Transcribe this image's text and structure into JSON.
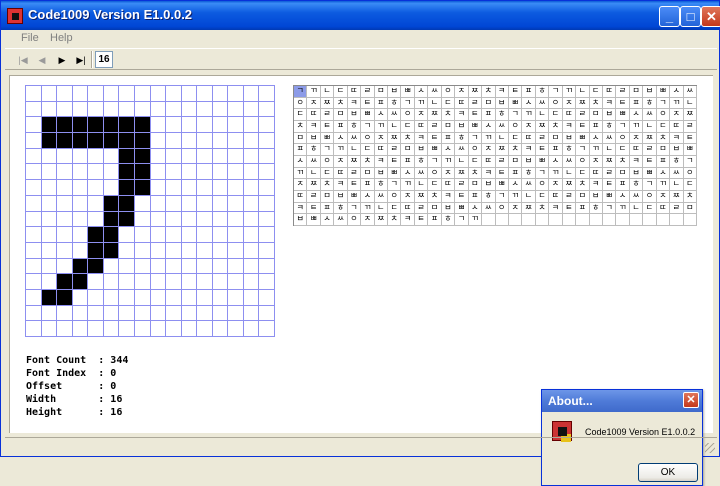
{
  "window": {
    "title": "Code1009 Version E1.0.0.2",
    "minimize_glyph": "_",
    "maximize_glyph": "□",
    "close_glyph": "✕",
    "icon": "app-icon"
  },
  "menu": {
    "file": "File",
    "help": "Help"
  },
  "toolbar": {
    "first_glyph": "|◀",
    "prev_glyph": "◀",
    "next_glyph": "▶",
    "last_glyph": "▶|",
    "index_value": "16"
  },
  "glyph": {
    "rows": 16,
    "cols": 16,
    "on_cells": [
      [
        2,
        1
      ],
      [
        2,
        2
      ],
      [
        2,
        3
      ],
      [
        2,
        4
      ],
      [
        2,
        5
      ],
      [
        2,
        6
      ],
      [
        2,
        7
      ],
      [
        3,
        1
      ],
      [
        3,
        2
      ],
      [
        3,
        3
      ],
      [
        3,
        4
      ],
      [
        3,
        5
      ],
      [
        3,
        6
      ],
      [
        3,
        7
      ],
      [
        4,
        6
      ],
      [
        4,
        7
      ],
      [
        5,
        6
      ],
      [
        5,
        7
      ],
      [
        6,
        6
      ],
      [
        6,
        7
      ],
      [
        7,
        5
      ],
      [
        7,
        6
      ],
      [
        8,
        5
      ],
      [
        8,
        6
      ],
      [
        9,
        4
      ],
      [
        9,
        5
      ],
      [
        10,
        4
      ],
      [
        10,
        5
      ],
      [
        11,
        3
      ],
      [
        11,
        4
      ],
      [
        12,
        2
      ],
      [
        12,
        3
      ],
      [
        13,
        1
      ],
      [
        13,
        2
      ]
    ]
  },
  "info": [
    {
      "label": "Font Count  : ",
      "value": "344"
    },
    {
      "label": "Font Index  : ",
      "value": "0"
    },
    {
      "label": "Offset      : ",
      "value": "0"
    },
    {
      "label": "Width       : ",
      "value": "16"
    },
    {
      "label": "Height      : ",
      "value": "16"
    }
  ],
  "font_table": {
    "cols": 30,
    "rows": 12,
    "filled_count": 344,
    "selected_index": 0,
    "glyphs": [
      "ㄱ",
      "ㄲ",
      "ㄴ",
      "ㄷ",
      "ㄸ",
      "ㄹ",
      "ㅁ",
      "ㅂ",
      "ㅃ",
      "ㅅ",
      "ㅆ",
      "ㅇ",
      "ㅈ",
      "ㅉ",
      "ㅊ",
      "ㅋ",
      "ㅌ",
      "ㅍ",
      "ㅎ"
    ]
  },
  "about": {
    "title": "About...",
    "close_glyph": "✕",
    "text": "Code1009 Version E1.0.0.2",
    "ok_label": "OK",
    "icon": "app-icon"
  }
}
